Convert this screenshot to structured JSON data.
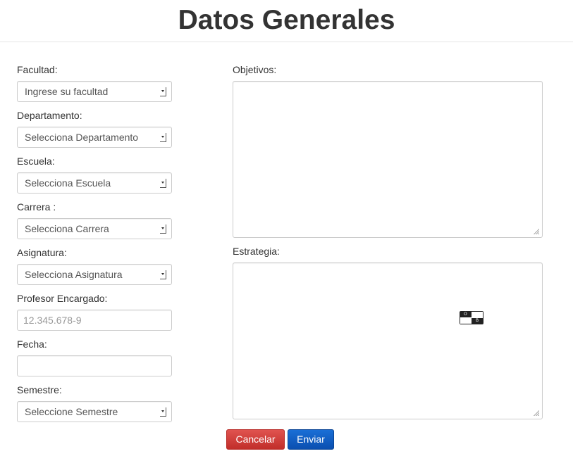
{
  "page": {
    "title": "Datos Generales"
  },
  "form": {
    "facultad": {
      "label": "Facultad:",
      "value": "Ingrese su facultad"
    },
    "departamento": {
      "label": "Departamento:",
      "value": "Selecciona Departamento"
    },
    "escuela": {
      "label": "Escuela:",
      "value": "Selecciona Escuela"
    },
    "carrera": {
      "label": "Carrera :",
      "value": "Selecciona Carrera"
    },
    "asignatura": {
      "label": "Asignatura:",
      "value": "Selecciona Asignatura"
    },
    "profesor": {
      "label": "Profesor Encargado:",
      "placeholder": "12.345.678-9",
      "value": ""
    },
    "fecha": {
      "label": "Fecha:",
      "value": ""
    },
    "semestre": {
      "label": "Semestre:",
      "value": "Seleccione Semestre"
    },
    "objetivos": {
      "label": "Objetivos:",
      "value": ""
    },
    "estrategia": {
      "label": "Estrategia:",
      "value": ""
    }
  },
  "buttons": {
    "cancel_label": "Cancelar",
    "send_label": "Enviar"
  },
  "overlay": {
    "ime_icon": "input-method-icon"
  },
  "colors": {
    "cancel_button": "#d9534f",
    "send_button": "#0e5bc4",
    "border": "#cccccc",
    "text": "#333333"
  }
}
